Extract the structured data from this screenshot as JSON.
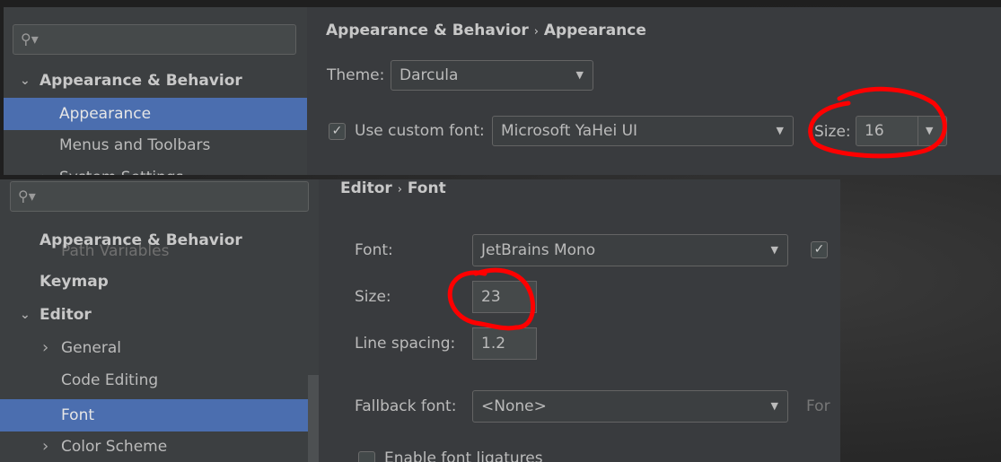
{
  "top": {
    "sidebar": {
      "search_placeholder": "",
      "items": [
        {
          "label": "Appearance & Behavior"
        },
        {
          "label": "Appearance"
        },
        {
          "label": "Menus and Toolbars"
        },
        {
          "label": "System Settings"
        }
      ]
    },
    "breadcrumb": [
      "Appearance & Behavior",
      "Appearance"
    ],
    "theme_label": "Theme:",
    "theme_value": "Darcula",
    "custom_font_label": "Use custom font:",
    "custom_font_checked": true,
    "custom_font_value": "Microsoft YaHei UI",
    "size_label": "Size:",
    "size_value": "16"
  },
  "bottom": {
    "sidebar": {
      "search_placeholder": "",
      "items": [
        {
          "label": "Appearance & Behavior"
        },
        {
          "label": "Path Variables"
        },
        {
          "label": "Keymap"
        },
        {
          "label": "Editor"
        },
        {
          "label": "General"
        },
        {
          "label": "Code Editing"
        },
        {
          "label": "Font"
        },
        {
          "label": "Color Scheme"
        }
      ]
    },
    "breadcrumb": [
      "Editor",
      "Font"
    ],
    "font_label": "Font:",
    "font_value": "JetBrains Mono",
    "size_label": "Size:",
    "size_value": "23",
    "line_spacing_label": "Line spacing:",
    "line_spacing_value": "1.2",
    "fallback_label": "Fallback font:",
    "fallback_value": "<None>",
    "fallback_hint": "For",
    "ligatures_label": "Enable font ligatures",
    "ligatures_checked": false
  },
  "colors": {
    "selection": "#4b6eaf",
    "annotation": "#ff0000"
  }
}
